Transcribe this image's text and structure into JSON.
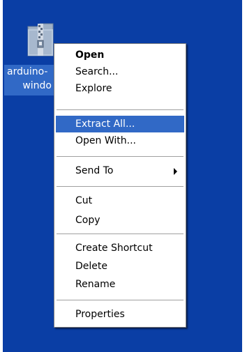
{
  "desktop": {
    "background_color": "#0a3ea5",
    "icon": {
      "icon_name": "zip-folder-icon",
      "label_line1": "arduino-",
      "label_line2": "windo"
    }
  },
  "context_menu": {
    "items": [
      {
        "label": "Open",
        "bold": true
      },
      {
        "label": "Search..."
      },
      {
        "label": "Explore"
      },
      {
        "label": "Extract All...",
        "highlighted": true
      },
      {
        "label": "Open With..."
      },
      {
        "label": "Send To",
        "submenu": true
      },
      {
        "label": "Cut"
      },
      {
        "label": "Copy"
      },
      {
        "label": "Create Shortcut"
      },
      {
        "label": "Delete"
      },
      {
        "label": "Rename"
      },
      {
        "label": "Properties"
      }
    ],
    "highlight_color": "#3169c6"
  }
}
